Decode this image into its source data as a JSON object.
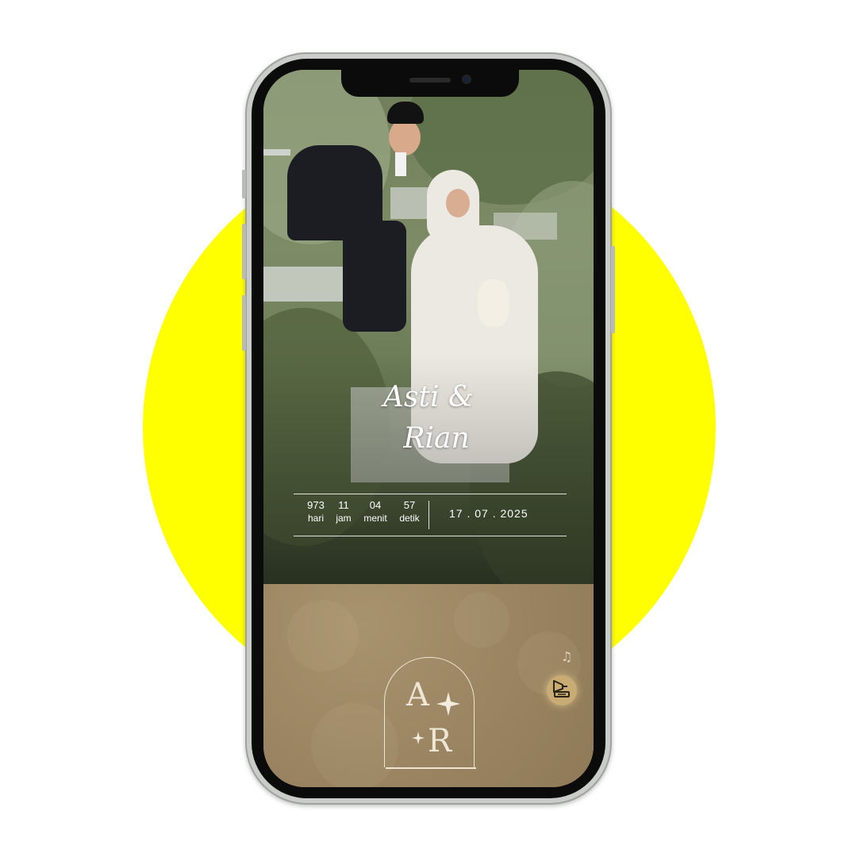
{
  "invitation": {
    "names_line1": "Asti &",
    "names_line2": "Rian",
    "countdown": [
      {
        "value": "973",
        "label": "hari"
      },
      {
        "value": "11",
        "label": "jam"
      },
      {
        "value": "04",
        "label": "menit"
      },
      {
        "value": "57",
        "label": "detik"
      }
    ],
    "date": "17 . 07 . 2025",
    "monogram": {
      "letter1": "A",
      "letter2": "R"
    }
  },
  "icons": {
    "music_notes": "music-notes-icon",
    "music_toggle": "gramophone-icon",
    "sparkle": "sparkle-icon"
  },
  "colors": {
    "background_circle": "#ffff00",
    "bottom_panel": "#9b8562",
    "music_button": "#c9ab74"
  }
}
